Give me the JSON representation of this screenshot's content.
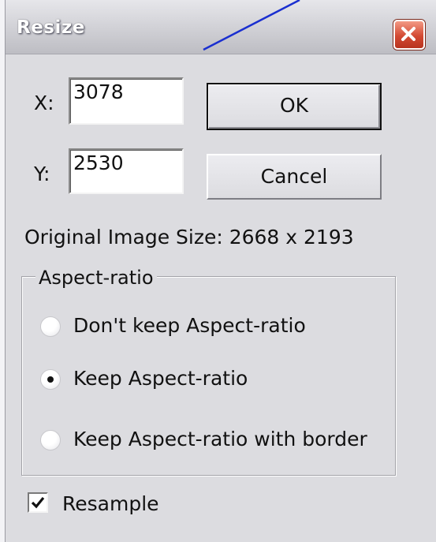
{
  "window": {
    "title": "Resize"
  },
  "fields": {
    "x_label": "X:",
    "x_value": "3078",
    "y_label": "Y:",
    "y_value": "2530"
  },
  "buttons": {
    "ok": "OK",
    "cancel": "Cancel"
  },
  "original_size": "Original Image Size: 2668 x 2193",
  "aspect": {
    "legend": "Aspect-ratio",
    "options": [
      {
        "label": "Don't keep Aspect-ratio",
        "selected": false
      },
      {
        "label": "Keep Aspect-ratio",
        "selected": true
      },
      {
        "label": "Keep Aspect-ratio with border",
        "selected": false
      }
    ]
  },
  "resample": {
    "label": "Resample",
    "checked": true
  },
  "icons": {
    "close": "close-icon",
    "check": "checkmark-icon",
    "pointer": "pointer-line"
  },
  "colors": {
    "close_button": "#d34a33",
    "pointer_line": "#1a2fd0",
    "dialog_bg": "#dcdce0"
  }
}
